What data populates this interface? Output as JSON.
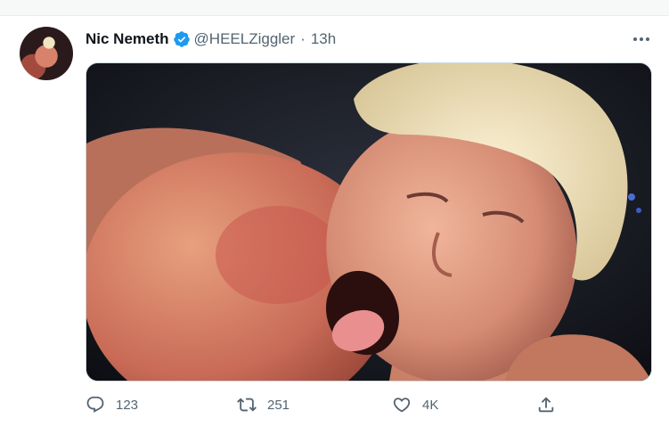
{
  "tweet": {
    "author": {
      "display_name": "Nic Nemeth",
      "handle": "@HEELZiggler",
      "verified": true
    },
    "separator": "·",
    "time": "13h",
    "media": {
      "type": "image",
      "content": "wrestler in headlock, blonde hair, mouth open, tongue out"
    },
    "actions": {
      "reply": {
        "icon": "reply-icon",
        "count": "123"
      },
      "retweet": {
        "icon": "retweet-icon",
        "count": "251"
      },
      "like": {
        "icon": "heart-icon",
        "count": "4K"
      },
      "share": {
        "icon": "share-icon"
      }
    }
  },
  "colors": {
    "verified": "#1d9bf0",
    "secondary_text": "#536471",
    "primary_text": "#0f1419"
  }
}
